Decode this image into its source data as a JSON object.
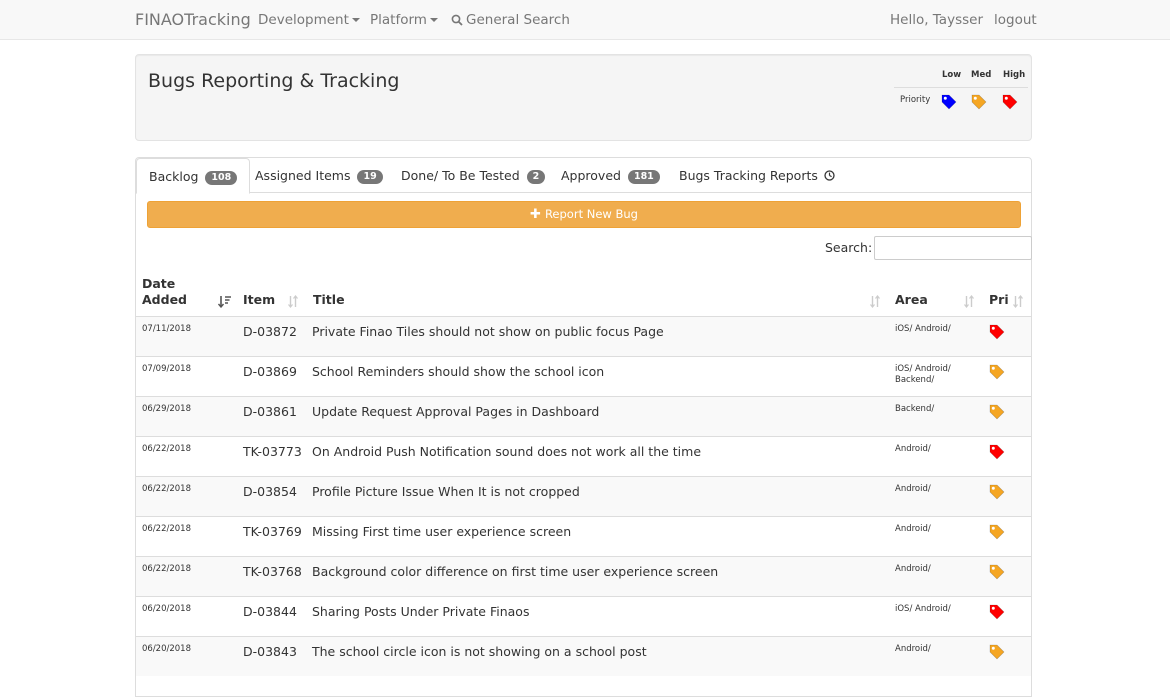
{
  "nav": {
    "brand": "FINAOTracking",
    "development": "Development",
    "platform": "Platform",
    "search": "General Search",
    "greeting": "Hello, Taysser",
    "logout": "logout"
  },
  "header": {
    "title": "Bugs Reporting & Tracking",
    "legend": {
      "low": "Low",
      "med": "Med",
      "high": "High",
      "priority": "Priority"
    }
  },
  "colors": {
    "low": "#0000ff",
    "med": "#f5a623",
    "high": "#ff0000",
    "button": "#f0ad4e",
    "badge": "#777777"
  },
  "tabs": [
    {
      "label": "Backlog",
      "badge": "108"
    },
    {
      "label": "Assigned Items",
      "badge": "19"
    },
    {
      "label": "Done/ To Be Tested",
      "badge": "2"
    },
    {
      "label": "Approved",
      "badge": "181"
    },
    {
      "label": "Bugs Tracking Reports"
    }
  ],
  "actions": {
    "report_button": "Report New Bug",
    "search_label": "Search:",
    "search_value": ""
  },
  "table": {
    "headers": {
      "date_line1": "Date",
      "date_line2": "Added",
      "item": "Item",
      "title": "Title",
      "area": "Area",
      "pri": "Pri"
    },
    "rows": [
      {
        "date": "07/11/2018",
        "item": "D-03872",
        "title": "Private Finao Tiles should not show on public focus Page",
        "area": "iOS/ Android/",
        "priority": "high"
      },
      {
        "date": "07/09/2018",
        "item": "D-03869",
        "title": "School Reminders should show the school icon",
        "area": "iOS/ Android/ Backend/",
        "priority": "med"
      },
      {
        "date": "06/29/2018",
        "item": "D-03861",
        "title": "Update Request Approval Pages in Dashboard",
        "area": "Backend/",
        "priority": "med"
      },
      {
        "date": "06/22/2018",
        "item": "TK-03773",
        "title": "On Android Push Notification sound does not work all the time",
        "area": "Android/",
        "priority": "high"
      },
      {
        "date": "06/22/2018",
        "item": "D-03854",
        "title": "Profile Picture Issue When It is not cropped",
        "area": "Android/",
        "priority": "med"
      },
      {
        "date": "06/22/2018",
        "item": "TK-03769",
        "title": "Missing First time user experience screen",
        "area": "Android/",
        "priority": "med"
      },
      {
        "date": "06/22/2018",
        "item": "TK-03768",
        "title": "Background color difference on first time user experience screen",
        "area": "Android/",
        "priority": "med"
      },
      {
        "date": "06/20/2018",
        "item": "D-03844",
        "title": "Sharing Posts Under Private Finaos",
        "area": "iOS/ Android/",
        "priority": "high"
      },
      {
        "date": "06/20/2018",
        "item": "D-03843",
        "title": "The school circle icon is not showing on a school post",
        "area": "Android/",
        "priority": "med"
      }
    ]
  }
}
